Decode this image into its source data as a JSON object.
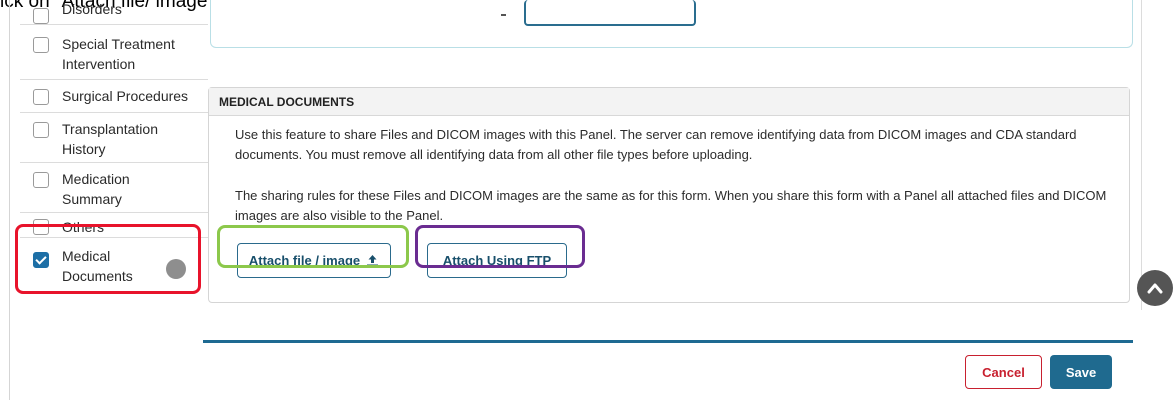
{
  "instruction": "ick on \"Attach file/ image\" (in green box) or \"Attach Using FTP\" (in purple box) to use the FTP interfa",
  "sidebar": {
    "items": [
      {
        "label": "Disorders",
        "checked": false
      },
      {
        "label": "Special Treatment Intervention",
        "checked": false
      },
      {
        "label": "Surgical Procedures",
        "checked": false
      },
      {
        "label": "Transplantation History",
        "checked": false
      },
      {
        "label": "Medication Summary",
        "checked": false
      },
      {
        "label": "Others",
        "checked": false
      },
      {
        "label": "Medical Documents",
        "checked": true
      }
    ]
  },
  "panel": {
    "title": "MEDICAL DOCUMENTS",
    "para1": "Use this feature to share Files and DICOM images with this Panel. The server can remove identifying data from DICOM images and CDA standard documents. You must remove all identifying data from all other file types before uploading.",
    "para2": "The sharing rules for these Files and DICOM images are the same as for this form. When you share this form with a Panel all attached files and DICOM images are also visible to the Panel.",
    "attach_label": "Attach file / image",
    "ftp_label": "Attach Using FTP"
  },
  "footer": {
    "cancel_label": "Cancel",
    "save_label": "Save"
  },
  "colors": {
    "accent": "#1f6a8f",
    "green_highlight": "#8cc84b",
    "purple_highlight": "#6a2c91",
    "red_highlight": "#e8132b",
    "cancel": "#c8202f"
  },
  "icons": {
    "attach": "upload-icon",
    "scroll_top": "chevron-up-icon"
  }
}
